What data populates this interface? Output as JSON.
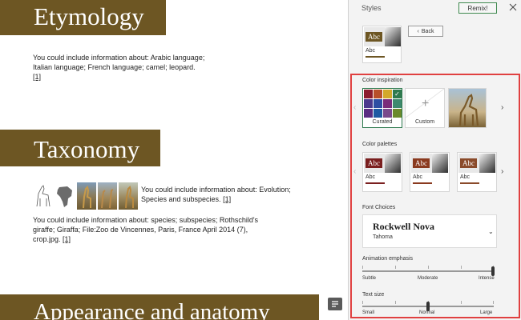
{
  "document": {
    "section1_title": "Etymology",
    "section1_text": "You could include information about: Arabic language; Italian language; French language; camel; leopard.",
    "section1_cite": "[1]",
    "section2_title": "Taxonomy",
    "section2_text": "You could include information about: Evolution; Species and subspecies.",
    "section2_cite": "[1]",
    "section2_text2": "You could include information about: species; subspecies; Rothschild's giraffe; Giraffa; File:Zoo de Vincennes, Paris, France April 2014 (7), crop.jpg.",
    "section2_cite2": "[1]",
    "section3_title": "Appearance and anatomy",
    "thumbnails": [
      "giraffe-sketch",
      "africa-map",
      "giraffe-photo",
      "giraffes-photo",
      "giraffe-photo"
    ]
  },
  "pane": {
    "title": "Styles",
    "remix_label": "Remix!",
    "back_label": "Back",
    "color_inspiration_label": "Color inspiration",
    "curated_label": "Curated",
    "custom_label": "Custom",
    "color_palettes_label": "Color palettes",
    "palette_sample_heading": "Abc",
    "palette_sample_sub": "Abc",
    "font_choices_label": "Font Choices",
    "font_heading": "Rockwell Nova",
    "font_body": "Tahoma",
    "animation_label": "Animation emphasis",
    "animation_scale": [
      "Subtle",
      "Moderate",
      "Intense"
    ],
    "animation_value": "Intense",
    "text_size_label": "Text size",
    "text_size_scale": [
      "Small",
      "Normal",
      "Large"
    ],
    "text_size_value": "Normal"
  },
  "colors": {
    "banner": "#6d5623",
    "accent_selected": "#2f7a4f",
    "highlight_border": "#e04040",
    "palette_abc_bg": "#7a1f1f",
    "swatches": [
      "#8b1e2d",
      "#b8502a",
      "#d3a82a",
      "#2f7a4f",
      "#4b3a8c",
      "#2d4fa3",
      "#7a2d7a",
      "#3e8a6e",
      "#5a2d82",
      "#1e5aa3",
      "#7a4a8c",
      "#6b8a2d"
    ]
  }
}
